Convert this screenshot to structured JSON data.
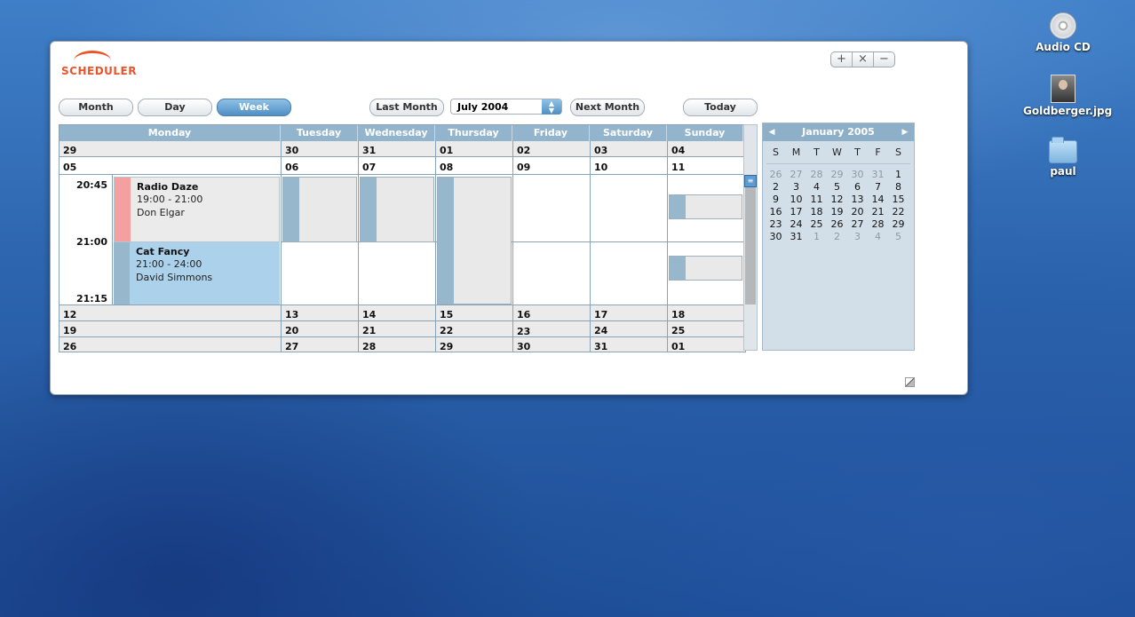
{
  "desktop": {
    "icons": [
      {
        "label": "Audio CD",
        "icon": "cd-icon"
      },
      {
        "label": "Goldberger.jpg",
        "icon": "image-file-icon"
      },
      {
        "label": "paul",
        "icon": "folder-icon"
      }
    ]
  },
  "app": {
    "logo_text": "SCHEDULER",
    "window_controls": [
      "+",
      "×",
      "−"
    ]
  },
  "toolbar": {
    "month": "Month",
    "day": "Day",
    "week": "Week",
    "last_month": "Last Month",
    "selected_month": "July 2004",
    "next_month": "Next Month",
    "today": "Today",
    "active_view": "Week"
  },
  "calendar": {
    "columns": [
      "Monday",
      "Tuesday",
      "Wednesday",
      "Thursday",
      "Friday",
      "Saturday",
      "Sunday"
    ],
    "weeks": [
      [
        "29",
        "30",
        "31",
        "01",
        "02",
        "03",
        "04"
      ],
      [
        "05",
        "06",
        "07",
        "08",
        "09",
        "10",
        "11"
      ],
      [
        "12",
        "13",
        "14",
        "15",
        "16",
        "17",
        "18"
      ],
      [
        "19",
        "20",
        "21",
        "22",
        "23",
        "24",
        "25"
      ],
      [
        "26",
        "27",
        "28",
        "29",
        "30",
        "31",
        "01"
      ]
    ],
    "times": [
      "20:45",
      "21:00",
      "21:15"
    ],
    "events": [
      {
        "title": "Radio Daze",
        "time": "19:00 - 21:00",
        "host": "Don Elgar",
        "color": "#f4a0a0"
      },
      {
        "title": "Cat Fancy",
        "time": "21:00 - 24:00",
        "host": "David Simmons",
        "color": "#97b8cc"
      }
    ]
  },
  "mini_calendar": {
    "title": "January 2005",
    "prev": "◀",
    "next": "▶",
    "dow": [
      "S",
      "M",
      "T",
      "W",
      "T",
      "F",
      "S"
    ],
    "days": [
      [
        "26",
        "27",
        "28",
        "29",
        "30",
        "31",
        "1"
      ],
      [
        "2",
        "3",
        "4",
        "5",
        "6",
        "7",
        "8"
      ],
      [
        "9",
        "10",
        "11",
        "12",
        "13",
        "14",
        "15"
      ],
      [
        "16",
        "17",
        "18",
        "19",
        "20",
        "21",
        "22"
      ],
      [
        "23",
        "24",
        "25",
        "26",
        "27",
        "28",
        "29"
      ],
      [
        "30",
        "31",
        "1",
        "2",
        "3",
        "4",
        "5"
      ]
    ]
  },
  "colors": {
    "accent": "#e8552a",
    "header": "#92b4cc",
    "active_button": "#4f8fc4"
  }
}
